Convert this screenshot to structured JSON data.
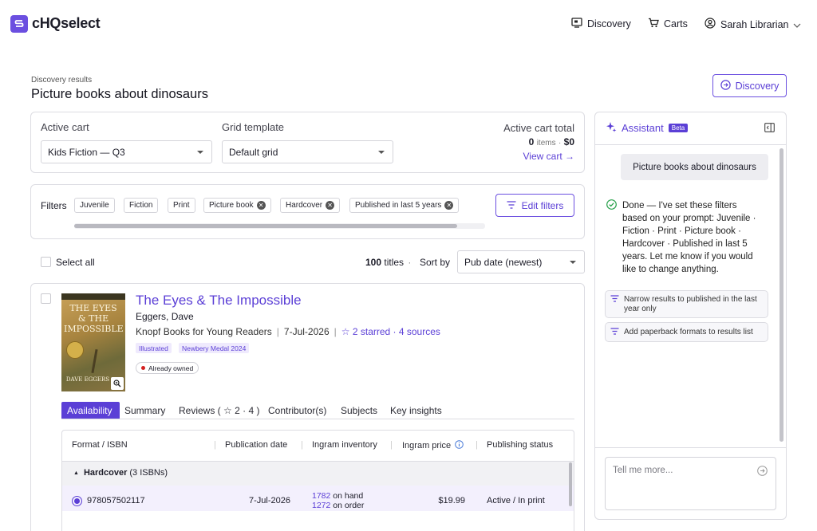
{
  "app": {
    "name": "cHQselect"
  },
  "nav": {
    "discovery": "Discovery",
    "carts": "Carts",
    "user": "Sarah Librarian"
  },
  "page": {
    "breadcrumb": "Discovery results",
    "title": "Picture books about dinosaurs",
    "discovery_button": "Discovery"
  },
  "cart_panel": {
    "active_cart_label": "Active cart",
    "active_cart_value": "Kids Fiction — Q3",
    "grid_template_label": "Grid template",
    "grid_template_value": "Default grid",
    "total_label": "Active cart total",
    "items_count": "0",
    "items_word": "items",
    "dot": "·",
    "total_amount": "$0",
    "view_cart": "View cart"
  },
  "filters": {
    "label": "Filters",
    "chips": [
      {
        "label": "Juvenile",
        "removable": false
      },
      {
        "label": "Fiction",
        "removable": false
      },
      {
        "label": "Print",
        "removable": false
      },
      {
        "label": "Picture book",
        "removable": true
      },
      {
        "label": "Hardcover",
        "removable": true
      },
      {
        "label": "Published in last 5 years",
        "removable": true
      }
    ],
    "edit_button": "Edit filters"
  },
  "results": {
    "select_all": "Select all",
    "count": "100",
    "count_word": "titles",
    "dot": "·",
    "sort_label": "Sort by",
    "sort_value": "Pub date (newest)"
  },
  "book": {
    "title": "The Eyes & The Impossible",
    "author": "Eggers, Dave",
    "publisher": "Knopf Books for Young Readers",
    "sep": "|",
    "date": "7-Jul-2026",
    "starred": "2 starred · 4 sources",
    "tags": [
      "Illustrated",
      "Newbery Medal 2024"
    ],
    "owned": "Already owned",
    "cover": {
      "line1": "THE EYES",
      "line2": "& THE",
      "line3": "IMPOSSIBLE",
      "author": "DAVE EGGERS"
    },
    "tabs": [
      "Availability",
      "Summary",
      "Reviews ( ☆ 2 · 4 )",
      "Contributor(s)",
      "Subjects",
      "Key insights"
    ],
    "table": {
      "headers": [
        "Format / ISBN",
        "Publication date",
        "Ingram inventory",
        "Ingram price",
        "Publishing status"
      ],
      "group": "Hardcover",
      "group_count": "(3 ISBNs)",
      "row": {
        "isbn": "978057502117",
        "date": "7-Jul-2026",
        "on_hand_num": "1782",
        "on_hand_text": "on hand",
        "on_order_num": "1272",
        "on_order_text": "on order",
        "price": "$19.99",
        "status": "Active / In print"
      }
    }
  },
  "assistant": {
    "title": "Assistant",
    "badge": "Beta",
    "user_msg": "Picture books about dinosaurs",
    "reply_lines": [
      "Done — I've set these filters",
      "based on your prompt: Juvenile ·",
      "Fiction · Print · Picture book ·",
      "Hardcover · Published in last 5",
      "years. Let me know if you would",
      "like to change anything."
    ],
    "suggestions": [
      "Narrow results to published in the last year only",
      "Add paperback formats to results list"
    ],
    "input_placeholder": "Tell me more..."
  },
  "colors": {
    "accent": "#5b3fd6",
    "accent_light": "#efeafd",
    "row_selected": "#f3f0fd",
    "owned_dot": "#d42020",
    "success": "#27a04a"
  }
}
